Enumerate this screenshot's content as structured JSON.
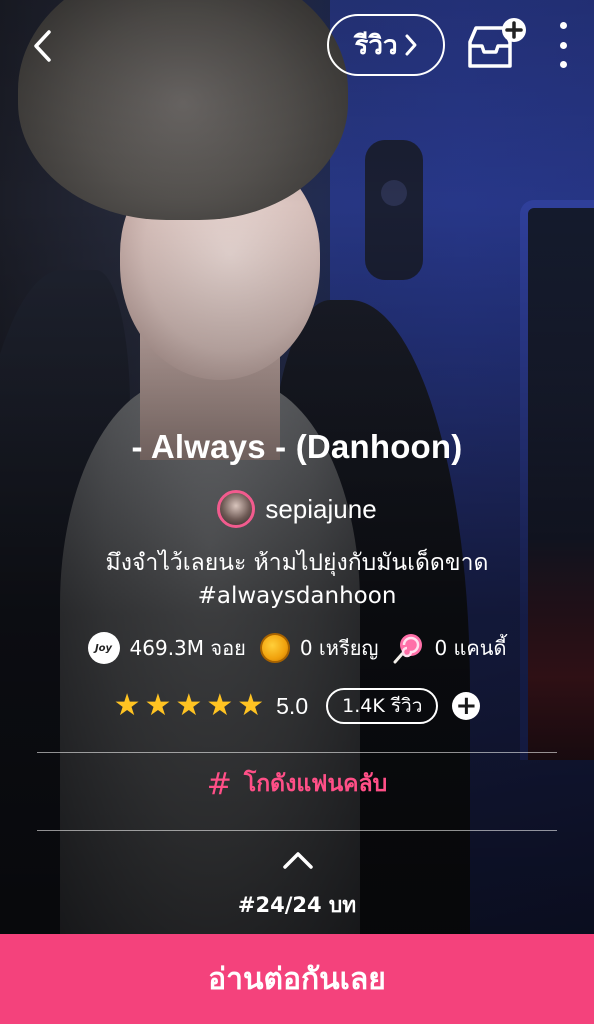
{
  "header": {
    "review_label": "รีวิว"
  },
  "story": {
    "title": "- Always - (Danhoon)",
    "author": "sepiajune",
    "description_line1": "มึงจำไว้เลยนะ ห้ามไปยุ่งกับมันเด็ดขาด",
    "description_line2": "#alwaysdanhoon"
  },
  "stats": {
    "joy_icon_text": "Joy",
    "joy_value": "469.3M จอย",
    "coin_value": "0 เหรียญ",
    "candy_value": "0 แคนดี้"
  },
  "rating": {
    "stars": [
      "★",
      "★",
      "★",
      "★",
      "★"
    ],
    "value": "5.0",
    "review_count": "1.4K รีวิว",
    "add_symbol": "+"
  },
  "fanclub": {
    "icon": "#",
    "label": "โกดังแฟนคลับ"
  },
  "episode": {
    "label": "#24/24 บท"
  },
  "cta": {
    "label": "อ่านต่อกันเลย"
  },
  "colors": {
    "accent": "#f4427c",
    "star": "#ffc322",
    "fanclub": "#ff4f87"
  }
}
